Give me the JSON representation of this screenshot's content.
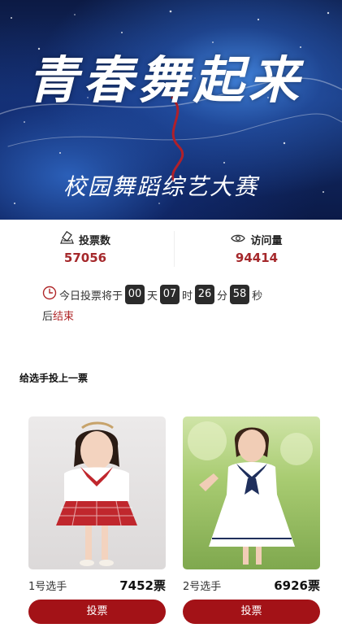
{
  "banner": {
    "title": "青春舞起来",
    "subtitle": "校园舞蹈综艺大赛"
  },
  "stats": {
    "votes": {
      "icon": "vote-icon",
      "label": "投票数",
      "value": "57056"
    },
    "visits": {
      "icon": "eye-icon",
      "label": "访问量",
      "value": "94414"
    }
  },
  "countdown": {
    "icon": "clock-icon",
    "prefix": "今日投票将于",
    "days": "00",
    "days_unit": "天",
    "hours": "07",
    "hours_unit": "时",
    "minutes": "26",
    "minutes_unit": "分",
    "seconds": "58",
    "seconds_unit": "秒",
    "suffix_plain": "后",
    "suffix_red": "结束"
  },
  "section_title": "给选手投上一票",
  "players": [
    {
      "name": "1号选手",
      "votes": "7452票",
      "button": "投票"
    },
    {
      "name": "2号选手",
      "votes": "6926票",
      "button": "投票"
    }
  ],
  "colors": {
    "accent": "#a31217",
    "value_red": "#a5282b",
    "countdown_box": "#2b2b2b"
  }
}
